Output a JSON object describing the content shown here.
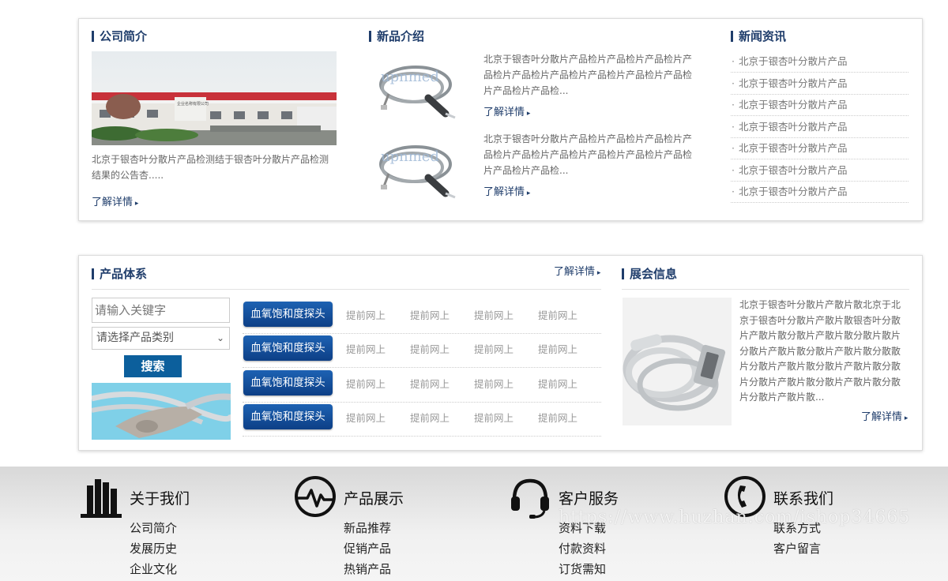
{
  "company": {
    "title": "公司简介",
    "text": "北京于银杏叶分散片产品检测结于银杏叶分散片产品检测结果的公告杏.....",
    "more": "了解详情",
    "sign_text": "企业名称有限公司"
  },
  "new_products": {
    "title": "新品介绍",
    "items": [
      {
        "text": "北京于银杏叶分散片产品检片产品检片产品检片产品检片产品检片产品检片产品检片产品检片产品检片产品检片产品检...",
        "more": "了解详情",
        "logo": "upnmed"
      },
      {
        "text": "北京于银杏叶分散片产品检片产品检片产品检片产品检片产品检片产品检片产品检片产品检片产品检片产品检片产品检...",
        "more": "了解详情",
        "logo": "upnmed"
      }
    ]
  },
  "news": {
    "title": "新闻资讯",
    "items": [
      "北京于银杏叶分散片产品",
      "北京于银杏叶分散片产品",
      "北京于银杏叶分散片产品",
      "北京于银杏叶分散片产品",
      "北京于银杏叶分散片产品",
      "北京于银杏叶分散片产品",
      "北京于银杏叶分散片产品"
    ]
  },
  "product_system": {
    "title": "产品体系",
    "more": "了解详情",
    "search_placeholder": "请输入关键字",
    "category_select": "请选择产品类别",
    "search_button": "搜索",
    "rows": [
      {
        "button": "血氧饱和度探头",
        "links": [
          "提前网上",
          "提前网上",
          "提前网上",
          "提前网上"
        ]
      },
      {
        "button": "血氧饱和度探头",
        "links": [
          "提前网上",
          "提前网上",
          "提前网上",
          "提前网上"
        ]
      },
      {
        "button": "血氧饱和度探头",
        "links": [
          "提前网上",
          "提前网上",
          "提前网上",
          "提前网上"
        ]
      },
      {
        "button": "血氧饱和度探头",
        "links": [
          "提前网上",
          "提前网上",
          "提前网上",
          "提前网上"
        ]
      }
    ]
  },
  "exhibition": {
    "title": "展会信息",
    "text": "北京于银杏叶分散片产散片散北京于北京于银杏叶分散片产散片散银杏叶分散片产散片散分散片产散片散分散片散片分散片产散片散分散片产散片散分散散片分散片产散片散分散片产散片散分散片分散片产散片散分散片产散片散分散片分散片产散片散...",
    "more": "了解详情"
  },
  "footer": {
    "columns": [
      {
        "icon": "building-icon",
        "title": "关于我们",
        "links": [
          "公司简介",
          "发展历史",
          "企业文化"
        ]
      },
      {
        "icon": "pulse-icon",
        "title": "产品展示",
        "links": [
          "新品推荐",
          "促销产品",
          "热销产品"
        ]
      },
      {
        "icon": "headset-icon",
        "title": "客户服务",
        "links": [
          "资料下载",
          "付款资料",
          "订货需知"
        ]
      },
      {
        "icon": "phone-icon",
        "title": "联系我们",
        "links": [
          "联系方式",
          "客户留言"
        ]
      }
    ],
    "watermark": "https://www.huzhan.com/ishop34665"
  },
  "colors": {
    "accent": "#1f3d6b",
    "button": "#0d4a96",
    "footer_bg": "#e6e6e6"
  }
}
